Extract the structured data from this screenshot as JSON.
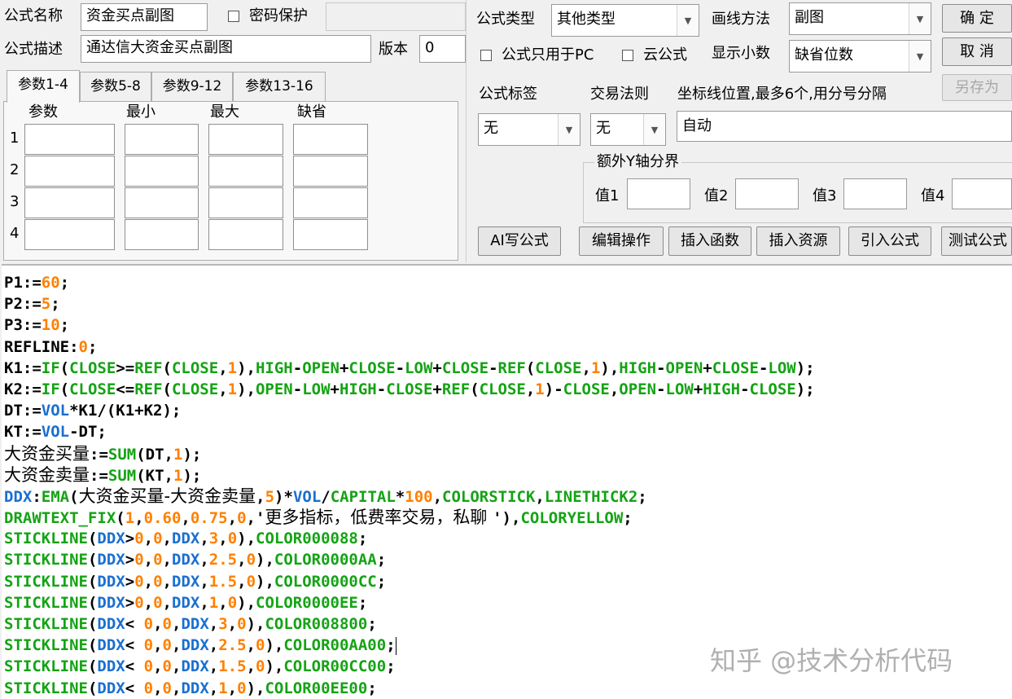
{
  "form": {
    "name_label": "公式名称",
    "name_value": "资金买点副图",
    "password_label": "密码保护",
    "password_value": "",
    "desc_label": "公式描述",
    "desc_value": "通达信大资金买点副图",
    "version_label": "版本",
    "version_value": "0",
    "type_label": "公式类型",
    "type_value": "其他类型",
    "draw_label": "画线方法",
    "draw_value": "副图",
    "pc_only_label": "公式只用于PC",
    "cloud_label": "云公式",
    "decimals_label": "显示小数",
    "decimals_value": "缺省位数",
    "tag_label": "公式标签",
    "tag_value": "无",
    "trade_label": "交易法则",
    "trade_value": "无",
    "axis_label": "坐标线位置,最多6个,用分号分隔",
    "axis_value": "自动",
    "yaxis_group": "额外Y轴分界",
    "y_labels": [
      "值1",
      "值2",
      "值3",
      "值4"
    ]
  },
  "buttons": {
    "ok": "确  定",
    "cancel": "取  消",
    "save_as": "另存为",
    "ai": "AI写公式",
    "edit_ops": "编辑操作",
    "insert_func": "插入函数",
    "insert_res": "插入资源",
    "import_formula": "引入公式",
    "test_formula": "测试公式"
  },
  "params": {
    "tabs": [
      "参数1-4",
      "参数5-8",
      "参数9-12",
      "参数13-16"
    ],
    "headers": [
      "参数",
      "最小",
      "最大",
      "缺省"
    ],
    "rows": [
      "1",
      "2",
      "3",
      "4"
    ]
  },
  "watermark": "知乎 @技术分析代码",
  "colors": {
    "variable": "#1a6fd1",
    "function": "#15a315",
    "number": "#ff8000",
    "text": "#000000"
  },
  "code_lines": [
    [
      {
        "t": "P1:=",
        "c": "text"
      },
      {
        "t": "60",
        "c": "number"
      },
      {
        "t": ";",
        "c": "text"
      }
    ],
    [
      {
        "t": "P2:=",
        "c": "text"
      },
      {
        "t": "5",
        "c": "number"
      },
      {
        "t": ";",
        "c": "text"
      }
    ],
    [
      {
        "t": "P3:=",
        "c": "text"
      },
      {
        "t": "10",
        "c": "number"
      },
      {
        "t": ";",
        "c": "text"
      }
    ],
    [
      {
        "t": "REFLINE:",
        "c": "text"
      },
      {
        "t": "0",
        "c": "number"
      },
      {
        "t": ";",
        "c": "text"
      }
    ],
    [
      {
        "t": "K1:=",
        "c": "text"
      },
      {
        "t": "IF",
        "c": "function"
      },
      {
        "t": "(",
        "c": "text"
      },
      {
        "t": "CLOSE",
        "c": "function"
      },
      {
        "t": ">=",
        "c": "text"
      },
      {
        "t": "REF",
        "c": "function"
      },
      {
        "t": "(",
        "c": "text"
      },
      {
        "t": "CLOSE",
        "c": "function"
      },
      {
        "t": ",",
        "c": "text"
      },
      {
        "t": "1",
        "c": "number"
      },
      {
        "t": "),",
        "c": "text"
      },
      {
        "t": "HIGH",
        "c": "function"
      },
      {
        "t": "-",
        "c": "text"
      },
      {
        "t": "OPEN",
        "c": "function"
      },
      {
        "t": "+",
        "c": "text"
      },
      {
        "t": "CLOSE",
        "c": "function"
      },
      {
        "t": "-",
        "c": "text"
      },
      {
        "t": "LOW",
        "c": "function"
      },
      {
        "t": "+",
        "c": "text"
      },
      {
        "t": "CLOSE",
        "c": "function"
      },
      {
        "t": "-",
        "c": "text"
      },
      {
        "t": "REF",
        "c": "function"
      },
      {
        "t": "(",
        "c": "text"
      },
      {
        "t": "CLOSE",
        "c": "function"
      },
      {
        "t": ",",
        "c": "text"
      },
      {
        "t": "1",
        "c": "number"
      },
      {
        "t": "),",
        "c": "text"
      },
      {
        "t": "HIGH",
        "c": "function"
      },
      {
        "t": "-",
        "c": "text"
      },
      {
        "t": "OPEN",
        "c": "function"
      },
      {
        "t": "+",
        "c": "text"
      },
      {
        "t": "CLOSE",
        "c": "function"
      },
      {
        "t": "-",
        "c": "text"
      },
      {
        "t": "LOW",
        "c": "function"
      },
      {
        "t": ");",
        "c": "text"
      }
    ],
    [
      {
        "t": "K2:=",
        "c": "text"
      },
      {
        "t": "IF",
        "c": "function"
      },
      {
        "t": "(",
        "c": "text"
      },
      {
        "t": "CLOSE",
        "c": "function"
      },
      {
        "t": "<=",
        "c": "text"
      },
      {
        "t": "REF",
        "c": "function"
      },
      {
        "t": "(",
        "c": "text"
      },
      {
        "t": "CLOSE",
        "c": "function"
      },
      {
        "t": ",",
        "c": "text"
      },
      {
        "t": "1",
        "c": "number"
      },
      {
        "t": "),",
        "c": "text"
      },
      {
        "t": "OPEN",
        "c": "function"
      },
      {
        "t": "-",
        "c": "text"
      },
      {
        "t": "LOW",
        "c": "function"
      },
      {
        "t": "+",
        "c": "text"
      },
      {
        "t": "HIGH",
        "c": "function"
      },
      {
        "t": "-",
        "c": "text"
      },
      {
        "t": "CLOSE",
        "c": "function"
      },
      {
        "t": "+",
        "c": "text"
      },
      {
        "t": "REF",
        "c": "function"
      },
      {
        "t": "(",
        "c": "text"
      },
      {
        "t": "CLOSE",
        "c": "function"
      },
      {
        "t": ",",
        "c": "text"
      },
      {
        "t": "1",
        "c": "number"
      },
      {
        "t": ")-",
        "c": "text"
      },
      {
        "t": "CLOSE",
        "c": "function"
      },
      {
        "t": ",",
        "c": "text"
      },
      {
        "t": "OPEN",
        "c": "function"
      },
      {
        "t": "-",
        "c": "text"
      },
      {
        "t": "LOW",
        "c": "function"
      },
      {
        "t": "+",
        "c": "text"
      },
      {
        "t": "HIGH",
        "c": "function"
      },
      {
        "t": "-",
        "c": "text"
      },
      {
        "t": "CLOSE",
        "c": "function"
      },
      {
        "t": ");",
        "c": "text"
      }
    ],
    [
      {
        "t": "DT:=",
        "c": "text"
      },
      {
        "t": "VOL",
        "c": "variable"
      },
      {
        "t": "*K1/(K1+K2);",
        "c": "text"
      }
    ],
    [
      {
        "t": "KT:=",
        "c": "text"
      },
      {
        "t": "VOL",
        "c": "variable"
      },
      {
        "t": "-DT;",
        "c": "text"
      }
    ],
    [
      {
        "t": "大资金买量",
        "c": "text",
        "zh": true
      },
      {
        "t": ":=",
        "c": "text"
      },
      {
        "t": "SUM",
        "c": "function"
      },
      {
        "t": "(DT,",
        "c": "text"
      },
      {
        "t": "1",
        "c": "number"
      },
      {
        "t": ");",
        "c": "text"
      }
    ],
    [
      {
        "t": "大资金卖量",
        "c": "text",
        "zh": true
      },
      {
        "t": ":=",
        "c": "text"
      },
      {
        "t": "SUM",
        "c": "function"
      },
      {
        "t": "(KT,",
        "c": "text"
      },
      {
        "t": "1",
        "c": "number"
      },
      {
        "t": ");",
        "c": "text"
      }
    ],
    [
      {
        "t": "DDX",
        "c": "variable"
      },
      {
        "t": ":",
        "c": "text"
      },
      {
        "t": "EMA",
        "c": "function"
      },
      {
        "t": "(",
        "c": "text"
      },
      {
        "t": "大资金买量-大资金卖量",
        "c": "text",
        "zh": true
      },
      {
        "t": ",",
        "c": "text"
      },
      {
        "t": "5",
        "c": "number"
      },
      {
        "t": ")*",
        "c": "text"
      },
      {
        "t": "VOL",
        "c": "variable"
      },
      {
        "t": "/",
        "c": "text"
      },
      {
        "t": "CAPITAL",
        "c": "function"
      },
      {
        "t": "*",
        "c": "text"
      },
      {
        "t": "100",
        "c": "number"
      },
      {
        "t": ",",
        "c": "text"
      },
      {
        "t": "COLORSTICK",
        "c": "function"
      },
      {
        "t": ",",
        "c": "text"
      },
      {
        "t": "LINETHICK2",
        "c": "function"
      },
      {
        "t": ";",
        "c": "text"
      }
    ],
    [
      {
        "t": "DRAWTEXT_FIX",
        "c": "function"
      },
      {
        "t": "(",
        "c": "text"
      },
      {
        "t": "1",
        "c": "number"
      },
      {
        "t": ",",
        "c": "text"
      },
      {
        "t": "0.60",
        "c": "number"
      },
      {
        "t": ",",
        "c": "text"
      },
      {
        "t": "0.75",
        "c": "number"
      },
      {
        "t": ",",
        "c": "text"
      },
      {
        "t": "0",
        "c": "number"
      },
      {
        "t": ",'",
        "c": "text"
      },
      {
        "t": "更多指标，低费率交易，私聊 ",
        "c": "text",
        "zh": true
      },
      {
        "t": "'),",
        "c": "text"
      },
      {
        "t": "COLORYELLOW",
        "c": "function"
      },
      {
        "t": ";",
        "c": "text"
      }
    ],
    [
      {
        "t": "STICKLINE",
        "c": "function"
      },
      {
        "t": "(",
        "c": "text"
      },
      {
        "t": "DDX",
        "c": "variable"
      },
      {
        "t": ">",
        "c": "text"
      },
      {
        "t": "0",
        "c": "number"
      },
      {
        "t": ",",
        "c": "text"
      },
      {
        "t": "0",
        "c": "number"
      },
      {
        "t": ",",
        "c": "text"
      },
      {
        "t": "DDX",
        "c": "variable"
      },
      {
        "t": ",",
        "c": "text"
      },
      {
        "t": "3",
        "c": "number"
      },
      {
        "t": ",",
        "c": "text"
      },
      {
        "t": "0",
        "c": "number"
      },
      {
        "t": "),",
        "c": "text"
      },
      {
        "t": "COLOR000088",
        "c": "function"
      },
      {
        "t": ";",
        "c": "text"
      }
    ],
    [
      {
        "t": "STICKLINE",
        "c": "function"
      },
      {
        "t": "(",
        "c": "text"
      },
      {
        "t": "DDX",
        "c": "variable"
      },
      {
        "t": ">",
        "c": "text"
      },
      {
        "t": "0",
        "c": "number"
      },
      {
        "t": ",",
        "c": "text"
      },
      {
        "t": "0",
        "c": "number"
      },
      {
        "t": ",",
        "c": "text"
      },
      {
        "t": "DDX",
        "c": "variable"
      },
      {
        "t": ",",
        "c": "text"
      },
      {
        "t": "2.5",
        "c": "number"
      },
      {
        "t": ",",
        "c": "text"
      },
      {
        "t": "0",
        "c": "number"
      },
      {
        "t": "),",
        "c": "text"
      },
      {
        "t": "COLOR0000AA",
        "c": "function"
      },
      {
        "t": ";",
        "c": "text"
      }
    ],
    [
      {
        "t": "STICKLINE",
        "c": "function"
      },
      {
        "t": "(",
        "c": "text"
      },
      {
        "t": "DDX",
        "c": "variable"
      },
      {
        "t": ">",
        "c": "text"
      },
      {
        "t": "0",
        "c": "number"
      },
      {
        "t": ",",
        "c": "text"
      },
      {
        "t": "0",
        "c": "number"
      },
      {
        "t": ",",
        "c": "text"
      },
      {
        "t": "DDX",
        "c": "variable"
      },
      {
        "t": ",",
        "c": "text"
      },
      {
        "t": "1.5",
        "c": "number"
      },
      {
        "t": ",",
        "c": "text"
      },
      {
        "t": "0",
        "c": "number"
      },
      {
        "t": "),",
        "c": "text"
      },
      {
        "t": "COLOR0000CC",
        "c": "function"
      },
      {
        "t": ";",
        "c": "text"
      }
    ],
    [
      {
        "t": "STICKLINE",
        "c": "function"
      },
      {
        "t": "(",
        "c": "text"
      },
      {
        "t": "DDX",
        "c": "variable"
      },
      {
        "t": ">",
        "c": "text"
      },
      {
        "t": "0",
        "c": "number"
      },
      {
        "t": ",",
        "c": "text"
      },
      {
        "t": "0",
        "c": "number"
      },
      {
        "t": ",",
        "c": "text"
      },
      {
        "t": "DDX",
        "c": "variable"
      },
      {
        "t": ",",
        "c": "text"
      },
      {
        "t": "1",
        "c": "number"
      },
      {
        "t": ",",
        "c": "text"
      },
      {
        "t": "0",
        "c": "number"
      },
      {
        "t": "),",
        "c": "text"
      },
      {
        "t": "COLOR0000EE",
        "c": "function"
      },
      {
        "t": ";",
        "c": "text"
      }
    ],
    [
      {
        "t": "STICKLINE",
        "c": "function"
      },
      {
        "t": "(",
        "c": "text"
      },
      {
        "t": "DDX",
        "c": "variable"
      },
      {
        "t": "< ",
        "c": "text"
      },
      {
        "t": "0",
        "c": "number"
      },
      {
        "t": ",",
        "c": "text"
      },
      {
        "t": "0",
        "c": "number"
      },
      {
        "t": ",",
        "c": "text"
      },
      {
        "t": "DDX",
        "c": "variable"
      },
      {
        "t": ",",
        "c": "text"
      },
      {
        "t": "3",
        "c": "number"
      },
      {
        "t": ",",
        "c": "text"
      },
      {
        "t": "0",
        "c": "number"
      },
      {
        "t": "),",
        "c": "text"
      },
      {
        "t": "COLOR008800",
        "c": "function"
      },
      {
        "t": ";",
        "c": "text"
      }
    ],
    [
      {
        "t": "STICKLINE",
        "c": "function"
      },
      {
        "t": "(",
        "c": "text"
      },
      {
        "t": "DDX",
        "c": "variable"
      },
      {
        "t": "< ",
        "c": "text"
      },
      {
        "t": "0",
        "c": "number"
      },
      {
        "t": ",",
        "c": "text"
      },
      {
        "t": "0",
        "c": "number"
      },
      {
        "t": ",",
        "c": "text"
      },
      {
        "t": "DDX",
        "c": "variable"
      },
      {
        "t": ",",
        "c": "text"
      },
      {
        "t": "2.5",
        "c": "number"
      },
      {
        "t": ",",
        "c": "text"
      },
      {
        "t": "0",
        "c": "number"
      },
      {
        "t": "),",
        "c": "text"
      },
      {
        "t": "COLOR00AA00",
        "c": "function"
      },
      {
        "t": ";",
        "c": "text",
        "caret": true
      }
    ],
    [
      {
        "t": "STICKLINE",
        "c": "function"
      },
      {
        "t": "(",
        "c": "text"
      },
      {
        "t": "DDX",
        "c": "variable"
      },
      {
        "t": "< ",
        "c": "text"
      },
      {
        "t": "0",
        "c": "number"
      },
      {
        "t": ",",
        "c": "text"
      },
      {
        "t": "0",
        "c": "number"
      },
      {
        "t": ",",
        "c": "text"
      },
      {
        "t": "DDX",
        "c": "variable"
      },
      {
        "t": ",",
        "c": "text"
      },
      {
        "t": "1.5",
        "c": "number"
      },
      {
        "t": ",",
        "c": "text"
      },
      {
        "t": "0",
        "c": "number"
      },
      {
        "t": "),",
        "c": "text"
      },
      {
        "t": "COLOR00CC00",
        "c": "function"
      },
      {
        "t": ";",
        "c": "text"
      }
    ],
    [
      {
        "t": "STICKLINE",
        "c": "function"
      },
      {
        "t": "(",
        "c": "text"
      },
      {
        "t": "DDX",
        "c": "variable"
      },
      {
        "t": "< ",
        "c": "text"
      },
      {
        "t": "0",
        "c": "number"
      },
      {
        "t": ",",
        "c": "text"
      },
      {
        "t": "0",
        "c": "number"
      },
      {
        "t": ",",
        "c": "text"
      },
      {
        "t": "DDX",
        "c": "variable"
      },
      {
        "t": ",",
        "c": "text"
      },
      {
        "t": "1",
        "c": "number"
      },
      {
        "t": ",",
        "c": "text"
      },
      {
        "t": "0",
        "c": "number"
      },
      {
        "t": "),",
        "c": "text"
      },
      {
        "t": "COLOR00EE00",
        "c": "function"
      },
      {
        "t": ";",
        "c": "text"
      }
    ]
  ]
}
